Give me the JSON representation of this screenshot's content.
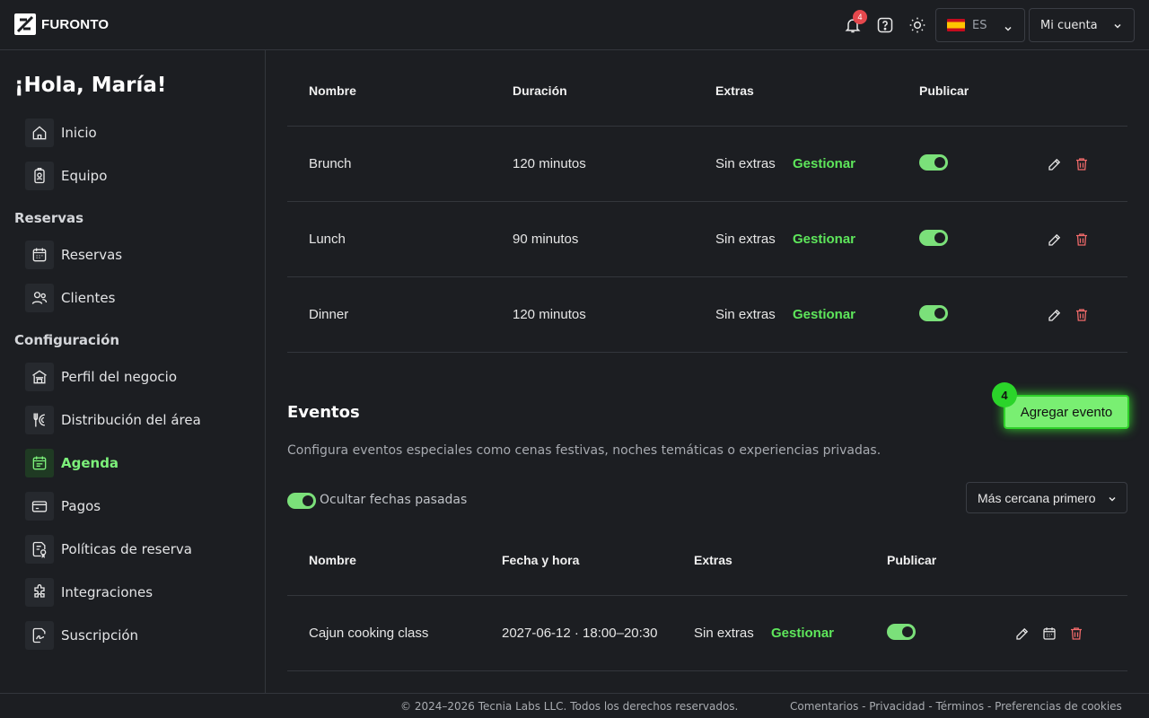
{
  "header": {
    "brand": "FURONTO",
    "notification_count": "4",
    "language": "ES",
    "account_label": "Mi cuenta"
  },
  "sidebar": {
    "greeting": "¡Hola, María!",
    "items_top": [
      {
        "label": "Inicio",
        "icon": "home-icon"
      },
      {
        "label": "Equipo",
        "icon": "badge-icon"
      }
    ],
    "section_reservas": "Reservas",
    "items_reservas": [
      {
        "label": "Reservas",
        "icon": "calendar-icon"
      },
      {
        "label": "Clientes",
        "icon": "users-icon"
      }
    ],
    "section_config": "Configuración",
    "items_config": [
      {
        "label": "Perfil del negocio",
        "icon": "store-icon"
      },
      {
        "label": "Distribución del área",
        "icon": "utensils-icon"
      },
      {
        "label": "Agenda",
        "icon": "schedule-icon",
        "active": true
      },
      {
        "label": "Pagos",
        "icon": "card-icon"
      },
      {
        "label": "Políticas de reserva",
        "icon": "policy-icon"
      },
      {
        "label": "Integraciones",
        "icon": "puzzle-icon"
      },
      {
        "label": "Suscripción",
        "icon": "signature-icon"
      }
    ]
  },
  "services_table": {
    "headers": [
      "Nombre",
      "Duración",
      "Extras",
      "Publicar"
    ],
    "rows": [
      {
        "name": "Brunch",
        "duration": "120 minutos",
        "extras": "Sin extras",
        "manage": "Gestionar",
        "published": true
      },
      {
        "name": "Lunch",
        "duration": "90 minutos",
        "extras": "Sin extras",
        "manage": "Gestionar",
        "published": true
      },
      {
        "name": "Dinner",
        "duration": "120 minutos",
        "extras": "Sin extras",
        "manage": "Gestionar",
        "published": true
      }
    ]
  },
  "events": {
    "title": "Eventos",
    "description": "Configura eventos especiales como cenas festivas, noches temáticas o experiencias privadas.",
    "add_button": "Agregar evento",
    "step_badge": "4",
    "hide_past_label": "Ocultar fechas pasadas",
    "hide_past": true,
    "sort_label": "Más cercana primero",
    "headers": [
      "Nombre",
      "Fecha y hora",
      "Extras",
      "Publicar"
    ],
    "rows": [
      {
        "name": "Cajun cooking class",
        "datetime": "2027-06-12 · 18:00–20:30",
        "extras": "Sin extras",
        "manage": "Gestionar",
        "published": true
      }
    ]
  },
  "footer": {
    "copyright": "© 2024–2026 Tecnia Labs LLC. Todos los derechos reservados.",
    "links": "Comentarios - Privacidad - Términos - Preferencias de cookies"
  },
  "colors": {
    "accent": "#5ee65b",
    "background": "#1c1e22",
    "danger": "#e5484d"
  }
}
